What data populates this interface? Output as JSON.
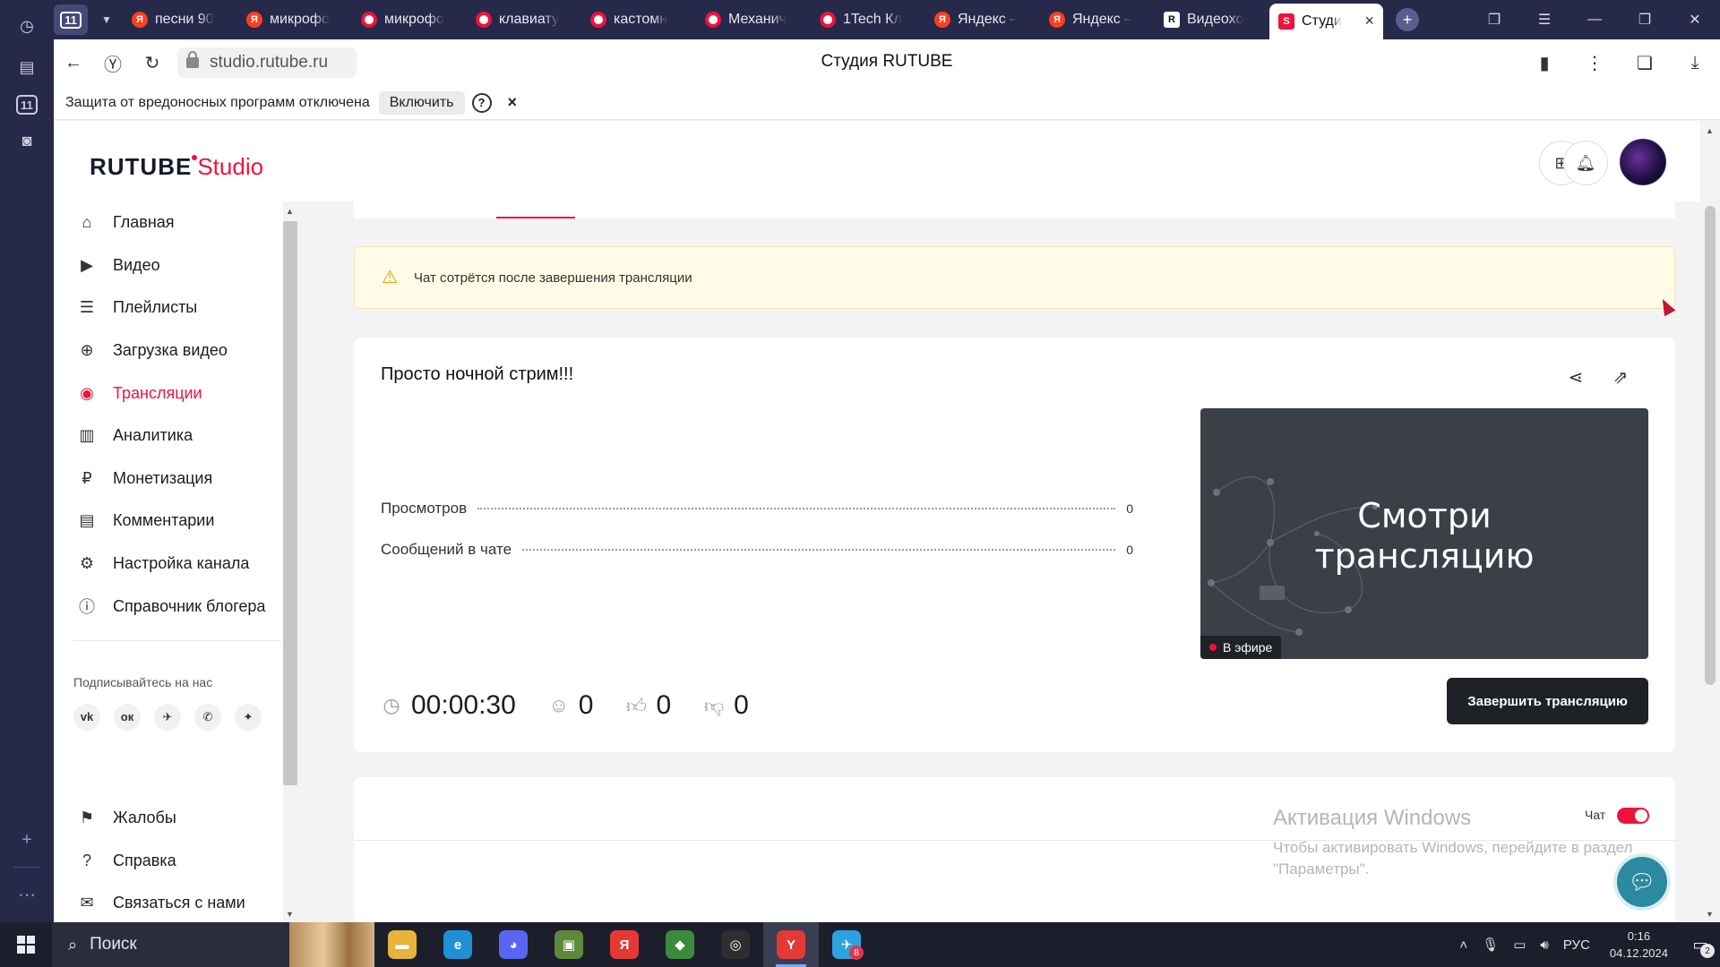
{
  "browser": {
    "tab_group_count": "11",
    "tabs": [
      {
        "title": "песни 90",
        "favicon": "ya"
      },
      {
        "title": "микрофо",
        "favicon": "ya"
      },
      {
        "title": "микрофо",
        "favicon": "rt"
      },
      {
        "title": "клавиату",
        "favicon": "rt"
      },
      {
        "title": "кастомн",
        "favicon": "rt"
      },
      {
        "title": "Механич",
        "favicon": "rt"
      },
      {
        "title": "1Tech Кл",
        "favicon": "rt"
      },
      {
        "title": "Яндекс –",
        "favicon": "ya"
      },
      {
        "title": "Яндекс –",
        "favicon": "ya"
      },
      {
        "title": "Видеохо",
        "favicon": "r"
      },
      {
        "title": "Студи",
        "favicon": "s",
        "active": true
      }
    ],
    "url": "studio.rutube.ru",
    "page_title": "Студия RUTUBE",
    "security_warning": {
      "text": "Защита от вредоносных программ отключена",
      "enable_label": "Включить",
      "help_label": "?",
      "close_label": "×"
    }
  },
  "studio": {
    "logo_brand": "RUTUBE",
    "logo_suffix": "Studio",
    "sidebar": {
      "items": [
        {
          "label": "Главная",
          "icon": "home-icon",
          "glyph": "⌂"
        },
        {
          "label": "Видео",
          "icon": "video-icon",
          "glyph": "▶"
        },
        {
          "label": "Плейлисты",
          "icon": "playlist-icon",
          "glyph": "☰"
        },
        {
          "label": "Загрузка видео",
          "icon": "upload-icon",
          "glyph": "⊕"
        },
        {
          "label": "Трансляции",
          "icon": "broadcast-icon",
          "glyph": "◉",
          "active": true
        },
        {
          "label": "Аналитика",
          "icon": "analytics-icon",
          "glyph": "▥"
        },
        {
          "label": "Монетизация",
          "icon": "monetization-icon",
          "glyph": "₽"
        },
        {
          "label": "Комментарии",
          "icon": "comments-icon",
          "glyph": "▤"
        },
        {
          "label": "Настройка канала",
          "icon": "settings-icon",
          "glyph": "⚙"
        },
        {
          "label": "Справочник блогера",
          "icon": "handbook-icon",
          "glyph": "ⓘ"
        }
      ],
      "follow_title": "Подписывайтесь на нас",
      "socials": [
        {
          "label": "vk",
          "icon": "vk-icon"
        },
        {
          "label": "ок",
          "icon": "ok-icon"
        },
        {
          "label": "✈",
          "icon": "telegram-icon"
        },
        {
          "label": "✆",
          "icon": "viber-icon"
        },
        {
          "label": "✦",
          "icon": "zen-icon"
        }
      ],
      "bottom_items": [
        {
          "label": "Жалобы",
          "icon": "flag-icon",
          "glyph": "⚑"
        },
        {
          "label": "Справка",
          "icon": "help-icon",
          "glyph": "?"
        },
        {
          "label": "Связаться с нами",
          "icon": "mail-icon",
          "glyph": "✉"
        }
      ]
    },
    "alert_text": "Чат сотрётся после завершения трансляции",
    "stream": {
      "title": "Просто ночной стрим!!!",
      "stats": [
        {
          "label": "Просмотров",
          "value": "0"
        },
        {
          "label": "Сообщений в чате",
          "value": "0"
        }
      ],
      "preview_line1": "Смотри",
      "preview_line2": "трансляцию",
      "live_label": "В эфире",
      "duration": "00:00:30",
      "viewers": "0",
      "likes": "0",
      "dislikes": "0",
      "end_button": "Завершить трансляцию"
    },
    "chat_label": "Чат",
    "chat_enabled": true
  },
  "windows_activation": {
    "title": "Активация Windows",
    "line1": "Чтобы активировать Windows, перейдите в раздел",
    "line2": "\"Параметры\"."
  },
  "taskbar": {
    "search_placeholder": "Поиск",
    "apps": [
      {
        "icon": "file-explorer-icon",
        "glyph": "▬",
        "color": "#e8b33a"
      },
      {
        "icon": "edge-icon",
        "glyph": "e",
        "color": "#1f8fd6"
      },
      {
        "icon": "discord-icon",
        "glyph": "◕",
        "color": "#5865f2"
      },
      {
        "icon": "minecraft-icon",
        "glyph": "▣",
        "color": "#5d8a3a"
      },
      {
        "icon": "yandex-icon",
        "glyph": "Я",
        "color": "#e53935"
      },
      {
        "icon": "shield-app-icon",
        "glyph": "◆",
        "color": "#3c8a3c"
      },
      {
        "icon": "obs-icon",
        "glyph": "◎",
        "color": "#2e2e2e"
      },
      {
        "icon": "yandex-browser-icon",
        "glyph": "Y",
        "color": "#e53935",
        "active": true
      },
      {
        "icon": "telegram-icon",
        "glyph": "✈",
        "color": "#2aa3df",
        "badge": "8"
      }
    ],
    "language": "РУС",
    "time": "0:16",
    "date": "04.12.2024",
    "notifications": "2"
  },
  "colors": {
    "accent": "#ed143b",
    "dark_button": "#1e2126",
    "alert_bg": "#fffbe6"
  }
}
